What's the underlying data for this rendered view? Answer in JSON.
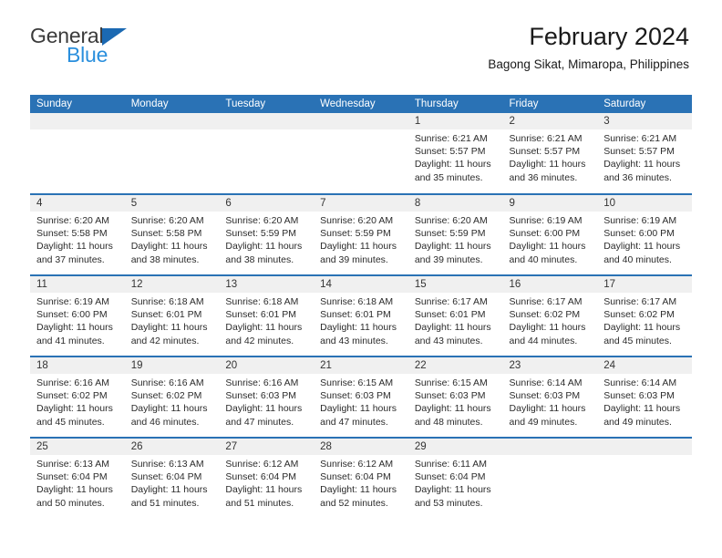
{
  "brand": {
    "name_top": "General",
    "name_bottom": "Blue",
    "triangle_color": "#1b69b2",
    "bottom_color": "#2a8fdd"
  },
  "header": {
    "title": "February 2024",
    "subtitle": "Bagong Sikat, Mimaropa, Philippines"
  },
  "theme": {
    "header_blue": "#2a72b5",
    "daynum_gray": "#f0f0f0",
    "text": "#2b2b2b"
  },
  "weekday_headers": [
    "Sunday",
    "Monday",
    "Tuesday",
    "Wednesday",
    "Thursday",
    "Friday",
    "Saturday"
  ],
  "weeks": [
    [
      {
        "day": "",
        "sunrise": "",
        "sunset": "",
        "daylight_1": "",
        "daylight_2": ""
      },
      {
        "day": "",
        "sunrise": "",
        "sunset": "",
        "daylight_1": "",
        "daylight_2": ""
      },
      {
        "day": "",
        "sunrise": "",
        "sunset": "",
        "daylight_1": "",
        "daylight_2": ""
      },
      {
        "day": "",
        "sunrise": "",
        "sunset": "",
        "daylight_1": "",
        "daylight_2": ""
      },
      {
        "day": "1",
        "sunrise": "Sunrise: 6:21 AM",
        "sunset": "Sunset: 5:57 PM",
        "daylight_1": "Daylight: 11 hours",
        "daylight_2": "and 35 minutes."
      },
      {
        "day": "2",
        "sunrise": "Sunrise: 6:21 AM",
        "sunset": "Sunset: 5:57 PM",
        "daylight_1": "Daylight: 11 hours",
        "daylight_2": "and 36 minutes."
      },
      {
        "day": "3",
        "sunrise": "Sunrise: 6:21 AM",
        "sunset": "Sunset: 5:57 PM",
        "daylight_1": "Daylight: 11 hours",
        "daylight_2": "and 36 minutes."
      }
    ],
    [
      {
        "day": "4",
        "sunrise": "Sunrise: 6:20 AM",
        "sunset": "Sunset: 5:58 PM",
        "daylight_1": "Daylight: 11 hours",
        "daylight_2": "and 37 minutes."
      },
      {
        "day": "5",
        "sunrise": "Sunrise: 6:20 AM",
        "sunset": "Sunset: 5:58 PM",
        "daylight_1": "Daylight: 11 hours",
        "daylight_2": "and 38 minutes."
      },
      {
        "day": "6",
        "sunrise": "Sunrise: 6:20 AM",
        "sunset": "Sunset: 5:59 PM",
        "daylight_1": "Daylight: 11 hours",
        "daylight_2": "and 38 minutes."
      },
      {
        "day": "7",
        "sunrise": "Sunrise: 6:20 AM",
        "sunset": "Sunset: 5:59 PM",
        "daylight_1": "Daylight: 11 hours",
        "daylight_2": "and 39 minutes."
      },
      {
        "day": "8",
        "sunrise": "Sunrise: 6:20 AM",
        "sunset": "Sunset: 5:59 PM",
        "daylight_1": "Daylight: 11 hours",
        "daylight_2": "and 39 minutes."
      },
      {
        "day": "9",
        "sunrise": "Sunrise: 6:19 AM",
        "sunset": "Sunset: 6:00 PM",
        "daylight_1": "Daylight: 11 hours",
        "daylight_2": "and 40 minutes."
      },
      {
        "day": "10",
        "sunrise": "Sunrise: 6:19 AM",
        "sunset": "Sunset: 6:00 PM",
        "daylight_1": "Daylight: 11 hours",
        "daylight_2": "and 40 minutes."
      }
    ],
    [
      {
        "day": "11",
        "sunrise": "Sunrise: 6:19 AM",
        "sunset": "Sunset: 6:00 PM",
        "daylight_1": "Daylight: 11 hours",
        "daylight_2": "and 41 minutes."
      },
      {
        "day": "12",
        "sunrise": "Sunrise: 6:18 AM",
        "sunset": "Sunset: 6:01 PM",
        "daylight_1": "Daylight: 11 hours",
        "daylight_2": "and 42 minutes."
      },
      {
        "day": "13",
        "sunrise": "Sunrise: 6:18 AM",
        "sunset": "Sunset: 6:01 PM",
        "daylight_1": "Daylight: 11 hours",
        "daylight_2": "and 42 minutes."
      },
      {
        "day": "14",
        "sunrise": "Sunrise: 6:18 AM",
        "sunset": "Sunset: 6:01 PM",
        "daylight_1": "Daylight: 11 hours",
        "daylight_2": "and 43 minutes."
      },
      {
        "day": "15",
        "sunrise": "Sunrise: 6:17 AM",
        "sunset": "Sunset: 6:01 PM",
        "daylight_1": "Daylight: 11 hours",
        "daylight_2": "and 43 minutes."
      },
      {
        "day": "16",
        "sunrise": "Sunrise: 6:17 AM",
        "sunset": "Sunset: 6:02 PM",
        "daylight_1": "Daylight: 11 hours",
        "daylight_2": "and 44 minutes."
      },
      {
        "day": "17",
        "sunrise": "Sunrise: 6:17 AM",
        "sunset": "Sunset: 6:02 PM",
        "daylight_1": "Daylight: 11 hours",
        "daylight_2": "and 45 minutes."
      }
    ],
    [
      {
        "day": "18",
        "sunrise": "Sunrise: 6:16 AM",
        "sunset": "Sunset: 6:02 PM",
        "daylight_1": "Daylight: 11 hours",
        "daylight_2": "and 45 minutes."
      },
      {
        "day": "19",
        "sunrise": "Sunrise: 6:16 AM",
        "sunset": "Sunset: 6:02 PM",
        "daylight_1": "Daylight: 11 hours",
        "daylight_2": "and 46 minutes."
      },
      {
        "day": "20",
        "sunrise": "Sunrise: 6:16 AM",
        "sunset": "Sunset: 6:03 PM",
        "daylight_1": "Daylight: 11 hours",
        "daylight_2": "and 47 minutes."
      },
      {
        "day": "21",
        "sunrise": "Sunrise: 6:15 AM",
        "sunset": "Sunset: 6:03 PM",
        "daylight_1": "Daylight: 11 hours",
        "daylight_2": "and 47 minutes."
      },
      {
        "day": "22",
        "sunrise": "Sunrise: 6:15 AM",
        "sunset": "Sunset: 6:03 PM",
        "daylight_1": "Daylight: 11 hours",
        "daylight_2": "and 48 minutes."
      },
      {
        "day": "23",
        "sunrise": "Sunrise: 6:14 AM",
        "sunset": "Sunset: 6:03 PM",
        "daylight_1": "Daylight: 11 hours",
        "daylight_2": "and 49 minutes."
      },
      {
        "day": "24",
        "sunrise": "Sunrise: 6:14 AM",
        "sunset": "Sunset: 6:03 PM",
        "daylight_1": "Daylight: 11 hours",
        "daylight_2": "and 49 minutes."
      }
    ],
    [
      {
        "day": "25",
        "sunrise": "Sunrise: 6:13 AM",
        "sunset": "Sunset: 6:04 PM",
        "daylight_1": "Daylight: 11 hours",
        "daylight_2": "and 50 minutes."
      },
      {
        "day": "26",
        "sunrise": "Sunrise: 6:13 AM",
        "sunset": "Sunset: 6:04 PM",
        "daylight_1": "Daylight: 11 hours",
        "daylight_2": "and 51 minutes."
      },
      {
        "day": "27",
        "sunrise": "Sunrise: 6:12 AM",
        "sunset": "Sunset: 6:04 PM",
        "daylight_1": "Daylight: 11 hours",
        "daylight_2": "and 51 minutes."
      },
      {
        "day": "28",
        "sunrise": "Sunrise: 6:12 AM",
        "sunset": "Sunset: 6:04 PM",
        "daylight_1": "Daylight: 11 hours",
        "daylight_2": "and 52 minutes."
      },
      {
        "day": "29",
        "sunrise": "Sunrise: 6:11 AM",
        "sunset": "Sunset: 6:04 PM",
        "daylight_1": "Daylight: 11 hours",
        "daylight_2": "and 53 minutes."
      },
      {
        "day": "",
        "sunrise": "",
        "sunset": "",
        "daylight_1": "",
        "daylight_2": ""
      },
      {
        "day": "",
        "sunrise": "",
        "sunset": "",
        "daylight_1": "",
        "daylight_2": ""
      }
    ]
  ]
}
